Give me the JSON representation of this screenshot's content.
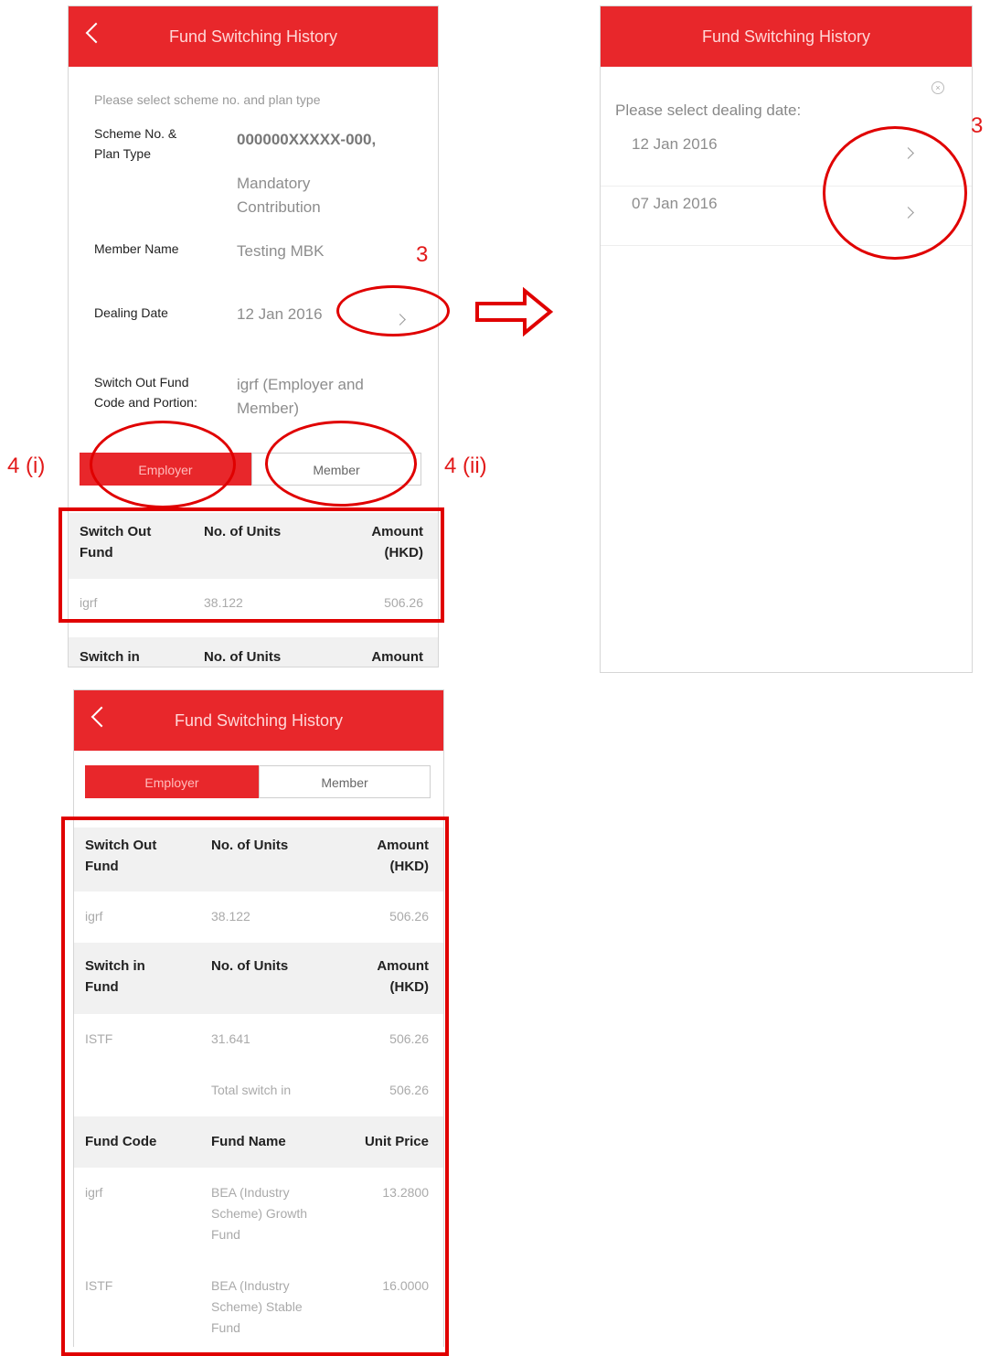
{
  "screen1": {
    "title": "Fund Switching History",
    "prompt": "Please select scheme no. and plan type",
    "scheme_label": "Scheme No. & Plan Type",
    "scheme_value": "000000XXXXX-000,",
    "plan_value": "Mandatory Contribution",
    "member_label": "Member Name",
    "member_value": "Testing MBK",
    "dealing_label": "Dealing Date",
    "dealing_value": "12 Jan 2016",
    "switch_label": "Switch Out Fund Code and Portion:",
    "switch_value": "igrf (Employer and Member)",
    "tabs": [
      "Employer",
      "Member"
    ],
    "table": {
      "headers": [
        "Switch Out Fund",
        "No. of Units",
        "Amount (HKD)"
      ],
      "row": [
        "igrf",
        "38.122",
        "506.26"
      ],
      "next_headers": [
        "Switch in",
        "No. of Units",
        "Amount"
      ]
    }
  },
  "screen2": {
    "title": "Fund Switching History",
    "close_glyph": "×",
    "prompt": "Please select dealing date:",
    "dates": [
      "12 Jan 2016",
      "07 Jan 2016"
    ]
  },
  "screen3": {
    "title": "Fund Switching History",
    "tabs": [
      "Employer",
      "Member"
    ],
    "out_headers": [
      "Switch Out Fund",
      "No. of Units",
      "Amount (HKD)"
    ],
    "out_row": [
      "igrf",
      "38.122",
      "506.26"
    ],
    "in_headers": [
      "Switch in Fund",
      "No. of Units",
      "Amount (HKD)"
    ],
    "in_row": [
      "ISTF",
      "31.641",
      "506.26"
    ],
    "total": [
      "Total switch in",
      "506.26"
    ],
    "code_headers": [
      "Fund Code",
      "Fund Name",
      "Unit Price"
    ],
    "funds": [
      {
        "code": "igrf",
        "name": "BEA (Industry Scheme) Growth Fund",
        "price": "13.2800"
      },
      {
        "code": "ISTF",
        "name": "BEA (Industry Scheme) Stable Fund",
        "price": "16.0000"
      }
    ]
  },
  "annotations": {
    "step3_a": "3",
    "step3_b": "3",
    "step4i": "4 (i)",
    "step4ii": "4 (ii)"
  },
  "colors": {
    "brand_red": "#e8272b",
    "annotation_red": "#e00000"
  }
}
